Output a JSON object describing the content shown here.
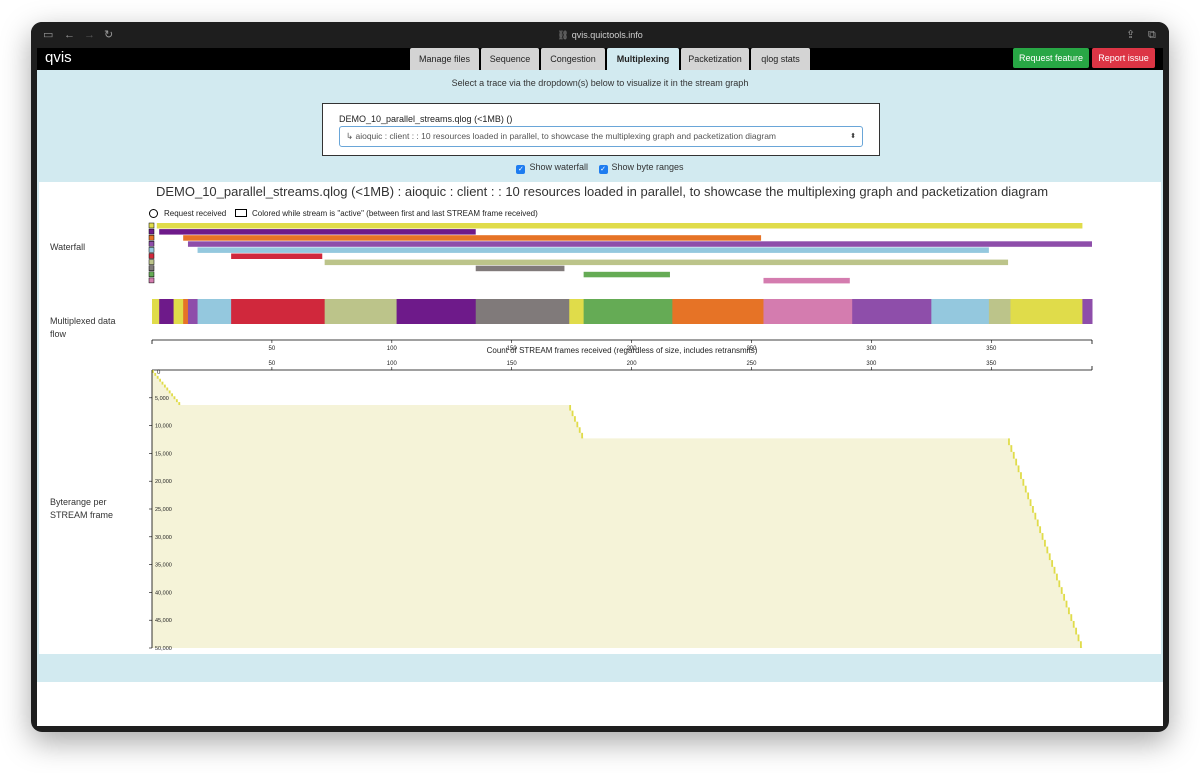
{
  "browser": {
    "url": "qvis.quictools.info",
    "icons": [
      "sidebar-icon",
      "back-icon",
      "forward-icon",
      "reload-icon",
      "link-icon",
      "share-icon",
      "tabs-icon"
    ]
  },
  "app": {
    "logo": "qvis",
    "tabs": [
      {
        "label": "Manage files",
        "active": false
      },
      {
        "label": "Sequence",
        "active": false
      },
      {
        "label": "Congestion",
        "active": false
      },
      {
        "label": "Multiplexing",
        "active": true
      },
      {
        "label": "Packetization",
        "active": false
      },
      {
        "label": "qlog stats",
        "active": false
      }
    ],
    "request_feature": "Request feature",
    "report_issue": "Report issue"
  },
  "selector": {
    "instructions": "Select a trace via the dropdown(s) below to visualize it in the stream graph",
    "file_label": "DEMO_10_parallel_streams.qlog (<1MB) ()",
    "trace_value": "↳ aioquic : client : : 10 resources loaded in parallel, to showcase the multiplexing graph and packetization diagram",
    "show_waterfall": "Show waterfall",
    "show_byte_ranges": "Show byte ranges"
  },
  "viz": {
    "title": "DEMO_10_parallel_streams.qlog (<1MB) : aioquic : client : : 10 resources loaded in parallel, to showcase the multiplexing graph and packetization diagram",
    "legend_request": "Request received",
    "legend_active": "Colored while stream is \"active\" (between first and last STREAM frame received)",
    "waterfall_label": "Waterfall",
    "multiplexed_label": "Multiplexed data flow",
    "byterange_label": "Byterange per STREAM frame"
  },
  "chart_data": {
    "type": "bar",
    "xlabel": "Count of STREAM frames received (regardless of size, includes retransmits)",
    "xlim": [
      0,
      392
    ],
    "x_ticks": [
      50,
      100,
      150,
      200,
      250,
      300,
      350
    ],
    "waterfall_streams": [
      {
        "color": "#e0dc4a",
        "start": 2,
        "end": 388
      },
      {
        "color": "#6e1a8a",
        "start": 3,
        "end": 135
      },
      {
        "color": "#e67326",
        "start": 13,
        "end": 254
      },
      {
        "color": "#8e4eaa",
        "start": 15,
        "end": 392
      },
      {
        "color": "#94c8de",
        "start": 19,
        "end": 349
      },
      {
        "color": "#d0283c",
        "start": 33,
        "end": 71
      },
      {
        "color": "#bcc48a",
        "start": 72,
        "end": 357
      },
      {
        "color": "#807a7a",
        "start": 135,
        "end": 172
      },
      {
        "color": "#65ab55",
        "start": 180,
        "end": 216
      },
      {
        "color": "#d47caf",
        "start": 255,
        "end": 291
      }
    ],
    "multiplexed_segments": [
      {
        "color": "#e0dc4a",
        "start": 0,
        "end": 3
      },
      {
        "color": "#6e1a8a",
        "start": 3,
        "end": 9
      },
      {
        "color": "#e0dc4a",
        "start": 9,
        "end": 13
      },
      {
        "color": "#e67326",
        "start": 13,
        "end": 15
      },
      {
        "color": "#8e4eaa",
        "start": 15,
        "end": 19
      },
      {
        "color": "#94c8de",
        "start": 19,
        "end": 33
      },
      {
        "color": "#d0283c",
        "start": 33,
        "end": 72
      },
      {
        "color": "#bcc48a",
        "start": 72,
        "end": 102
      },
      {
        "color": "#6e1a8a",
        "start": 102,
        "end": 135
      },
      {
        "color": "#807a7a",
        "start": 135,
        "end": 174
      },
      {
        "color": "#e0dc4a",
        "start": 174,
        "end": 180
      },
      {
        "color": "#65ab55",
        "start": 180,
        "end": 217
      },
      {
        "color": "#e67326",
        "start": 217,
        "end": 255
      },
      {
        "color": "#d47caf",
        "start": 255,
        "end": 292
      },
      {
        "color": "#8e4eaa",
        "start": 292,
        "end": 325
      },
      {
        "color": "#94c8de",
        "start": 325,
        "end": 349
      },
      {
        "color": "#bcc48a",
        "start": 349,
        "end": 358
      },
      {
        "color": "#e0dc4a",
        "start": 358,
        "end": 388
      },
      {
        "color": "#8e4eaa",
        "start": 388,
        "end": 392
      }
    ],
    "byterange": {
      "ylim": [
        0,
        50000
      ],
      "y_ticks": [
        5000,
        10000,
        15000,
        20000,
        25000,
        30000,
        35000,
        40000,
        45000,
        50000
      ],
      "y_tick_labels": [
        "5,000",
        "10,000",
        "15,000",
        "20,000",
        "25,000",
        "30,000",
        "35,000",
        "40,000",
        "45,000",
        "50,000"
      ],
      "zero_label": "0",
      "fill_color": "#f5f3d8",
      "stroke_color": "#e0dc4a",
      "profile": [
        [
          0,
          0
        ],
        [
          12,
          6300
        ],
        [
          174,
          6300
        ],
        [
          180,
          12300
        ],
        [
          357,
          12300
        ],
        [
          388,
          50000
        ]
      ]
    }
  }
}
